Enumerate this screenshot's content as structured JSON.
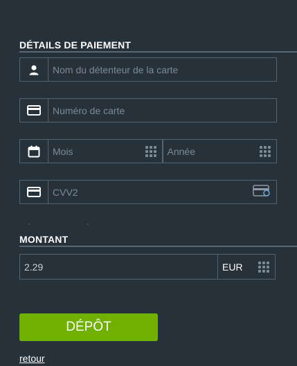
{
  "payment_details": {
    "title": "DÉTAILS DE PAIEMENT",
    "cardholder": {
      "placeholder": "Nom du détenteur de la carte",
      "icon": "user-icon"
    },
    "card_number": {
      "placeholder": "Numéro de carte",
      "icon": "credit-card-icon"
    },
    "expiry": {
      "icon": "calendar-icon",
      "month_placeholder": "Mois",
      "year_placeholder": "Année"
    },
    "cvv": {
      "placeholder": "CVV2",
      "icon": "credit-card-icon"
    }
  },
  "amount": {
    "title": "MONTANT",
    "value": "2.29",
    "currency": "EUR"
  },
  "actions": {
    "deposit_label": "DÉPÔT",
    "back_label": "retour"
  },
  "colors": {
    "background": "#27313a",
    "border": "#566370",
    "accent": "#6fb000",
    "placeholder": "#7d8a96"
  }
}
